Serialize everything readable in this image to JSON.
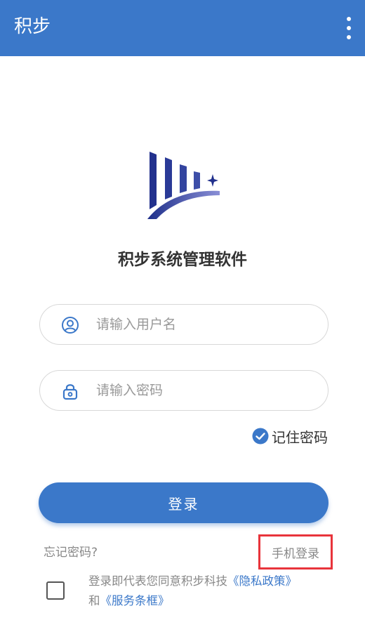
{
  "app_bar": {
    "title": "积步",
    "menu_icon": "more-vertical-icon",
    "background_color": "#3b78c9"
  },
  "logo": {
    "icon": "company-logo-icon",
    "colors": [
      "#1e2f8a",
      "#5b63c4"
    ]
  },
  "app_name": "积步系统管理软件",
  "login_form": {
    "username": {
      "icon": "user-icon",
      "placeholder": "请输入用户名",
      "value": ""
    },
    "password": {
      "icon": "lock-icon",
      "placeholder": "请输入密码",
      "value": ""
    },
    "remember_password": {
      "label": "记住密码",
      "checked": true,
      "icon": "check-circle-icon"
    },
    "login_button_label": "登录"
  },
  "footer": {
    "forgot_password": "忘记密码?",
    "phone_login": "手机登录",
    "agreement": {
      "checked": false,
      "text_prefix": "登录即代表您同意积步科技",
      "privacy_link": "《隐私政策》",
      "connector": "和",
      "terms_link": "《服务条框》"
    }
  },
  "colors": {
    "primary": "#3b78c9",
    "highlight_border": "#e8343b"
  }
}
